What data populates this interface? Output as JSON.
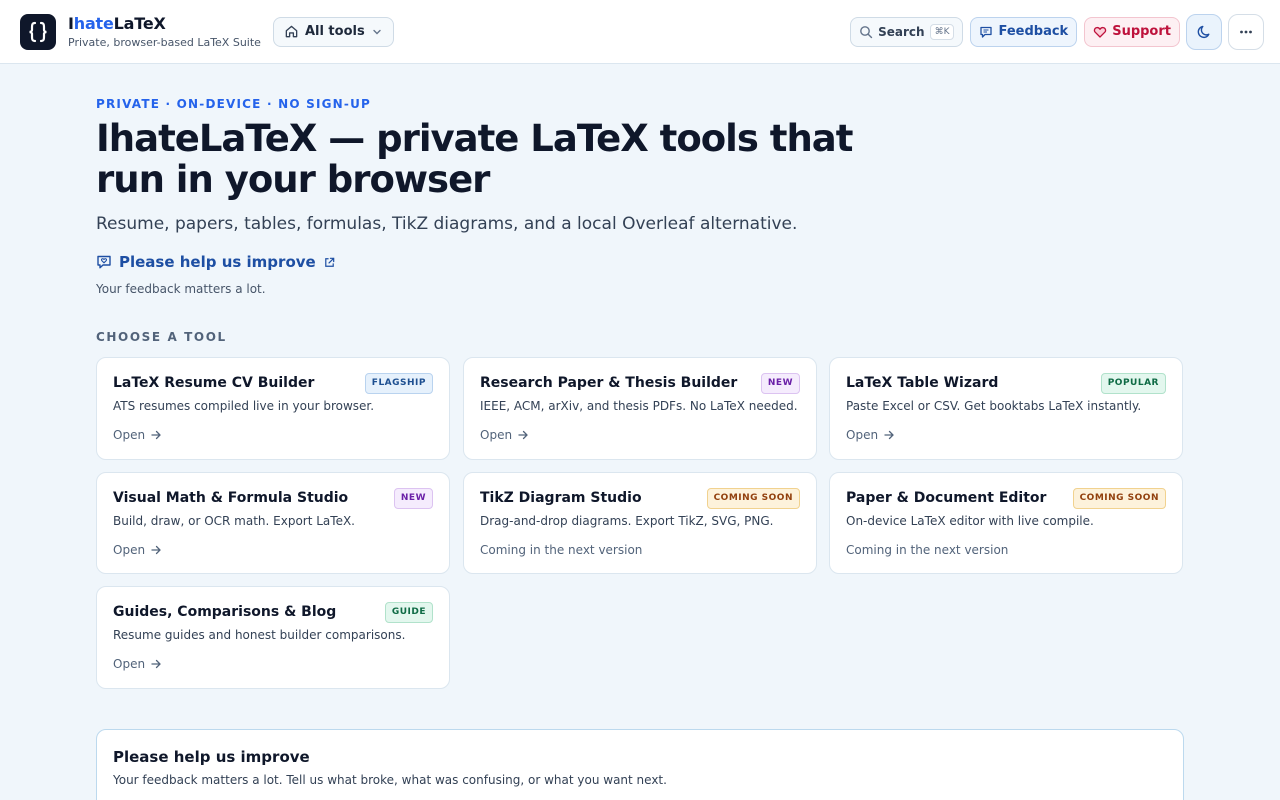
{
  "header": {
    "brand_prefix": "I",
    "brand_highlight": "hate",
    "brand_suffix": "LaTeX",
    "brand_tagline": "Private, browser-based LaTeX Suite",
    "all_tools_label": "All tools",
    "search_label": "Search",
    "search_shortcut": "⌘K",
    "feedback_label": "Feedback",
    "support_label": "Support"
  },
  "hero": {
    "eyebrow": "PRIVATE · ON-DEVICE · NO SIGN-UP",
    "title": "IhateLaTeX — private LaTeX tools that run in your browser",
    "subtitle": "Resume, papers, tables, formulas, TikZ diagrams, and a local Overleaf alternative.",
    "improve_link": "Please help us improve",
    "improve_note": "Your feedback matters a lot."
  },
  "tools_section": {
    "label": "CHOOSE A TOOL",
    "cards": [
      {
        "title": "LaTeX Resume CV Builder",
        "badge": "FLAGSHIP",
        "desc": "ATS resumes compiled live in your browser.",
        "footer": "Open"
      },
      {
        "title": "Research Paper & Thesis Builder",
        "badge": "NEW",
        "desc": "IEEE, ACM, arXiv, and thesis PDFs. No LaTeX needed.",
        "footer": "Open"
      },
      {
        "title": "LaTeX Table Wizard",
        "badge": "POPULAR",
        "desc": "Paste Excel or CSV. Get booktabs LaTeX instantly.",
        "footer": "Open"
      },
      {
        "title": "Visual Math & Formula Studio",
        "badge": "NEW",
        "desc": "Build, draw, or OCR math. Export LaTeX.",
        "footer": "Open"
      },
      {
        "title": "TikZ Diagram Studio",
        "badge": "COMING SOON",
        "desc": "Drag-and-drop diagrams. Export TikZ, SVG, PNG.",
        "footer": "Coming in the next version"
      },
      {
        "title": "Paper & Document Editor",
        "badge": "COMING SOON",
        "desc": "On-device LaTeX editor with live compile.",
        "footer": "Coming in the next version"
      },
      {
        "title": "Guides, Comparisons & Blog",
        "badge": "GUIDE",
        "desc": "Resume guides and honest builder comparisons.",
        "footer": "Open"
      }
    ]
  },
  "feedback_panel": {
    "title": "Please help us improve",
    "text": "Your feedback matters a lot. Tell us what broke, what was confusing, or what you want next."
  }
}
